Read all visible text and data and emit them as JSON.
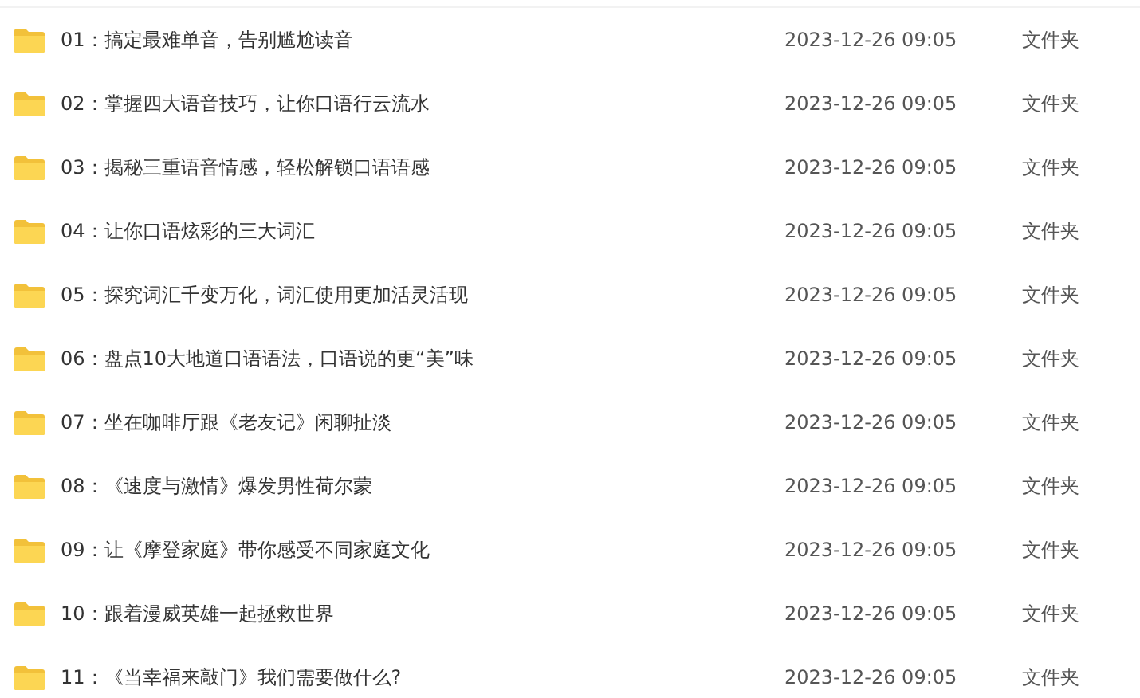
{
  "files": [
    {
      "name": "01：搞定最难单音，告别尴尬读音",
      "modified": "2023-12-26 09:05",
      "type": "文件夹"
    },
    {
      "name": "02：掌握四大语音技巧，让你口语行云流水",
      "modified": "2023-12-26 09:05",
      "type": "文件夹"
    },
    {
      "name": "03：揭秘三重语音情感，轻松解锁口语语感",
      "modified": "2023-12-26 09:05",
      "type": "文件夹"
    },
    {
      "name": "04：让你口语炫彩的三大词汇",
      "modified": "2023-12-26 09:05",
      "type": "文件夹"
    },
    {
      "name": "05：探究词汇千变万化，词汇使用更加活灵活现",
      "modified": "2023-12-26 09:05",
      "type": "文件夹"
    },
    {
      "name": "06：盘点10大地道口语语法，口语说的更“美”味",
      "modified": "2023-12-26 09:05",
      "type": "文件夹"
    },
    {
      "name": "07：坐在咖啡厅跟《老友记》闲聊扯淡",
      "modified": "2023-12-26 09:05",
      "type": "文件夹"
    },
    {
      "name": "08：《速度与激情》爆发男性荷尔蒙",
      "modified": "2023-12-26 09:05",
      "type": "文件夹"
    },
    {
      "name": "09：让《摩登家庭》带你感受不同家庭文化",
      "modified": "2023-12-26 09:05",
      "type": "文件夹"
    },
    {
      "name": "10：跟着漫威英雄一起拯救世界",
      "modified": "2023-12-26 09:05",
      "type": "文件夹"
    },
    {
      "name": "11：《当幸福来敲门》我们需要做什么?",
      "modified": "2023-12-26 09:05",
      "type": "文件夹"
    }
  ]
}
